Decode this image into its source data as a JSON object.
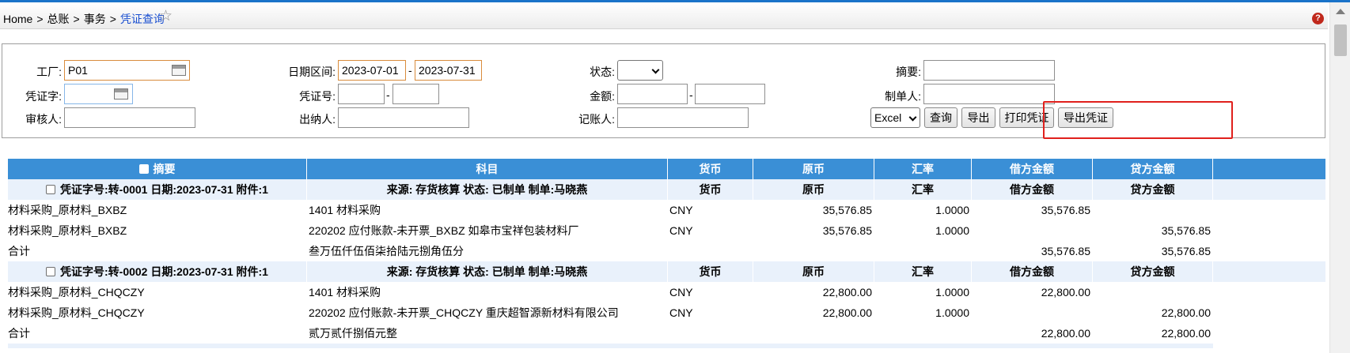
{
  "breadcrumb": {
    "home": "Home",
    "sep": ">",
    "level1": "总账",
    "level2": "事务",
    "current": "凭证查询"
  },
  "filters": {
    "factory_label": "工厂:",
    "factory_value": "P01",
    "voucher_type_label": "凭证字:",
    "voucher_type_value": "",
    "reviewer_label": "审核人:",
    "reviewer_value": "",
    "date_range_label": "日期区间:",
    "date_from": "2023-07-01",
    "date_to": "2023-07-31",
    "range_sep": "-",
    "voucher_no_label": "凭证号:",
    "voucher_no_from": "",
    "voucher_no_to": "",
    "cashier_label": "出纳人:",
    "cashier_value": "",
    "status_label": "状态:",
    "status_value": "",
    "amount_label": "金额:",
    "amount_from": "",
    "amount_to": "",
    "bookkeeper_label": "记账人:",
    "bookkeeper_value": "",
    "summary_label": "摘要:",
    "summary_value": "",
    "creator_label": "制单人:",
    "creator_value": "",
    "format_value": "Excel"
  },
  "buttons": {
    "query": "查询",
    "export": "导出",
    "print": "打印凭证",
    "export_voucher": "导出凭证"
  },
  "table": {
    "headers": [
      "摘要",
      "科目",
      "货币",
      "原币",
      "汇率",
      "借方金额",
      "贷方金额"
    ],
    "vouchers": [
      {
        "title": "凭证字号:转-0001 日期:2023-07-31 附件:1",
        "source": "来源: 存货核算 状态: 已制单 制单:马晓燕",
        "sub_headers": [
          "货币",
          "原币",
          "汇率",
          "借方金额",
          "贷方金额"
        ],
        "lines": [
          {
            "summary": "材料采购_原材料_BXBZ",
            "account": "1401 材料采购",
            "currency": "CNY",
            "original": "35,576.85",
            "rate": "1.0000",
            "debit": "35,576.85",
            "credit": ""
          },
          {
            "summary": "材料采购_原材料_BXBZ",
            "account": "220202 应付账款-未开票_BXBZ 如皋市宝祥包装材料厂",
            "currency": "CNY",
            "original": "35,576.85",
            "rate": "1.0000",
            "debit": "",
            "credit": "35,576.85"
          }
        ],
        "total": {
          "label": "合计",
          "words": "叁万伍仟伍佰柒拾陆元捌角伍分",
          "debit": "35,576.85",
          "credit": "35,576.85"
        }
      },
      {
        "title": "凭证字号:转-0002 日期:2023-07-31 附件:1",
        "source": "来源: 存货核算 状态: 已制单 制单:马晓燕",
        "sub_headers": [
          "货币",
          "原币",
          "汇率",
          "借方金额",
          "贷方金额"
        ],
        "lines": [
          {
            "summary": "材料采购_原材料_CHQCZY",
            "account": "1401 材料采购",
            "currency": "CNY",
            "original": "22,800.00",
            "rate": "1.0000",
            "debit": "22,800.00",
            "credit": ""
          },
          {
            "summary": "材料采购_原材料_CHQCZY",
            "account": "220202 应付账款-未开票_CHQCZY 重庆超智源新材料有限公司",
            "currency": "CNY",
            "original": "22,800.00",
            "rate": "1.0000",
            "debit": "",
            "credit": "22,800.00"
          }
        ],
        "total": {
          "label": "合计",
          "words": "贰万贰仟捌佰元整",
          "debit": "22,800.00",
          "credit": "22,800.00"
        }
      }
    ]
  },
  "colors": {
    "header_bg": "#3a8fd6",
    "group_bg": "#e9f1fb",
    "highlight": "#e0201c",
    "breadcrumb_current": "#1a4fd0"
  },
  "icons": {
    "favorite": "star-outline-icon",
    "help": "question-icon",
    "calendar": "calendar-icon"
  }
}
